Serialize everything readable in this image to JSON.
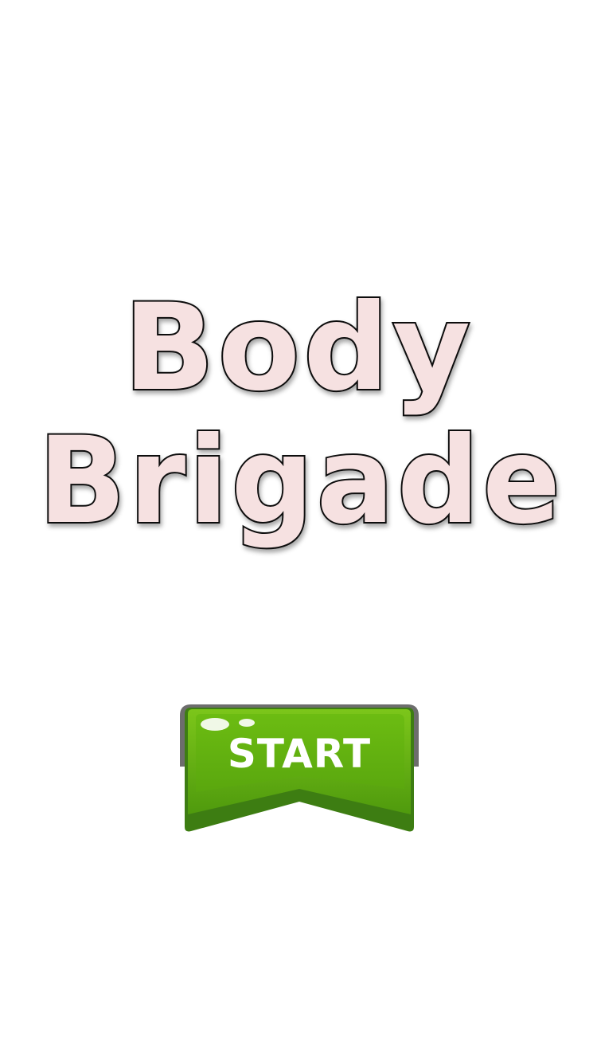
{
  "title": {
    "line1": "Body",
    "line2": "Brigade"
  },
  "start_button": {
    "label": "START"
  },
  "colors": {
    "background": "#ffffff",
    "title_fill": "#f6e1e1",
    "title_outline": "#111111",
    "button_green": "#58a80c",
    "button_dark_green": "#3d7d12",
    "button_rim": "#6d6d6d"
  }
}
